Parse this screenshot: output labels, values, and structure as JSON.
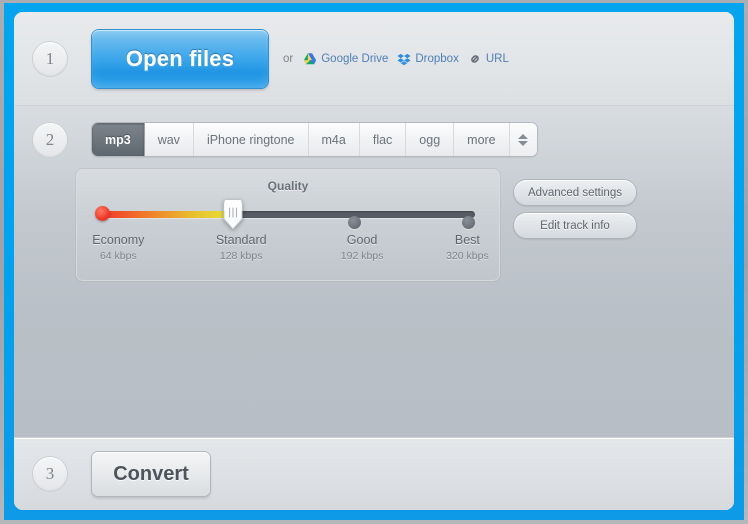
{
  "window": {
    "frame_color": "#00a3f0",
    "body_bg": "#dcdfe2"
  },
  "step1": {
    "number": "1",
    "open_files_label": "Open files",
    "or_label": "or",
    "sources": [
      {
        "label": "Google Drive",
        "icon": "google-drive-icon"
      },
      {
        "label": "Dropbox",
        "icon": "dropbox-icon"
      },
      {
        "label": "URL",
        "icon": "link-icon"
      }
    ]
  },
  "step2": {
    "number": "2",
    "format_tabs": [
      {
        "label": "mp3",
        "active": true
      },
      {
        "label": "wav",
        "active": false
      },
      {
        "label": "iPhone ringtone",
        "active": false
      },
      {
        "label": "m4a",
        "active": false
      },
      {
        "label": "flac",
        "active": false
      },
      {
        "label": "ogg",
        "active": false
      },
      {
        "label": "more",
        "active": false
      }
    ],
    "spinner": {
      "up_icon": "chevron-up-icon",
      "down_icon": "chevron-down-icon"
    },
    "quality": {
      "title": "Quality",
      "selected_index": 1,
      "selected_label": "Standard",
      "selected_bitrate": "128 kbps",
      "fill_gradient": [
        "#ef3b2c",
        "#f08b2b",
        "#e6e639"
      ],
      "track_color": "#565d64",
      "steps": [
        {
          "name": "Economy",
          "bitrate": "64 kbps",
          "pos": 2.0
        },
        {
          "name": "Standard",
          "bitrate": "128 kbps",
          "pos": 36.0
        },
        {
          "name": "Good",
          "bitrate": "192 kbps",
          "pos": 68.0
        },
        {
          "name": "Best",
          "bitrate": "320 kbps",
          "pos": 98.0
        }
      ]
    },
    "side_buttons": [
      {
        "label": "Advanced settings"
      },
      {
        "label": "Edit track info"
      }
    ]
  },
  "step3": {
    "number": "3",
    "convert_label": "Convert"
  }
}
